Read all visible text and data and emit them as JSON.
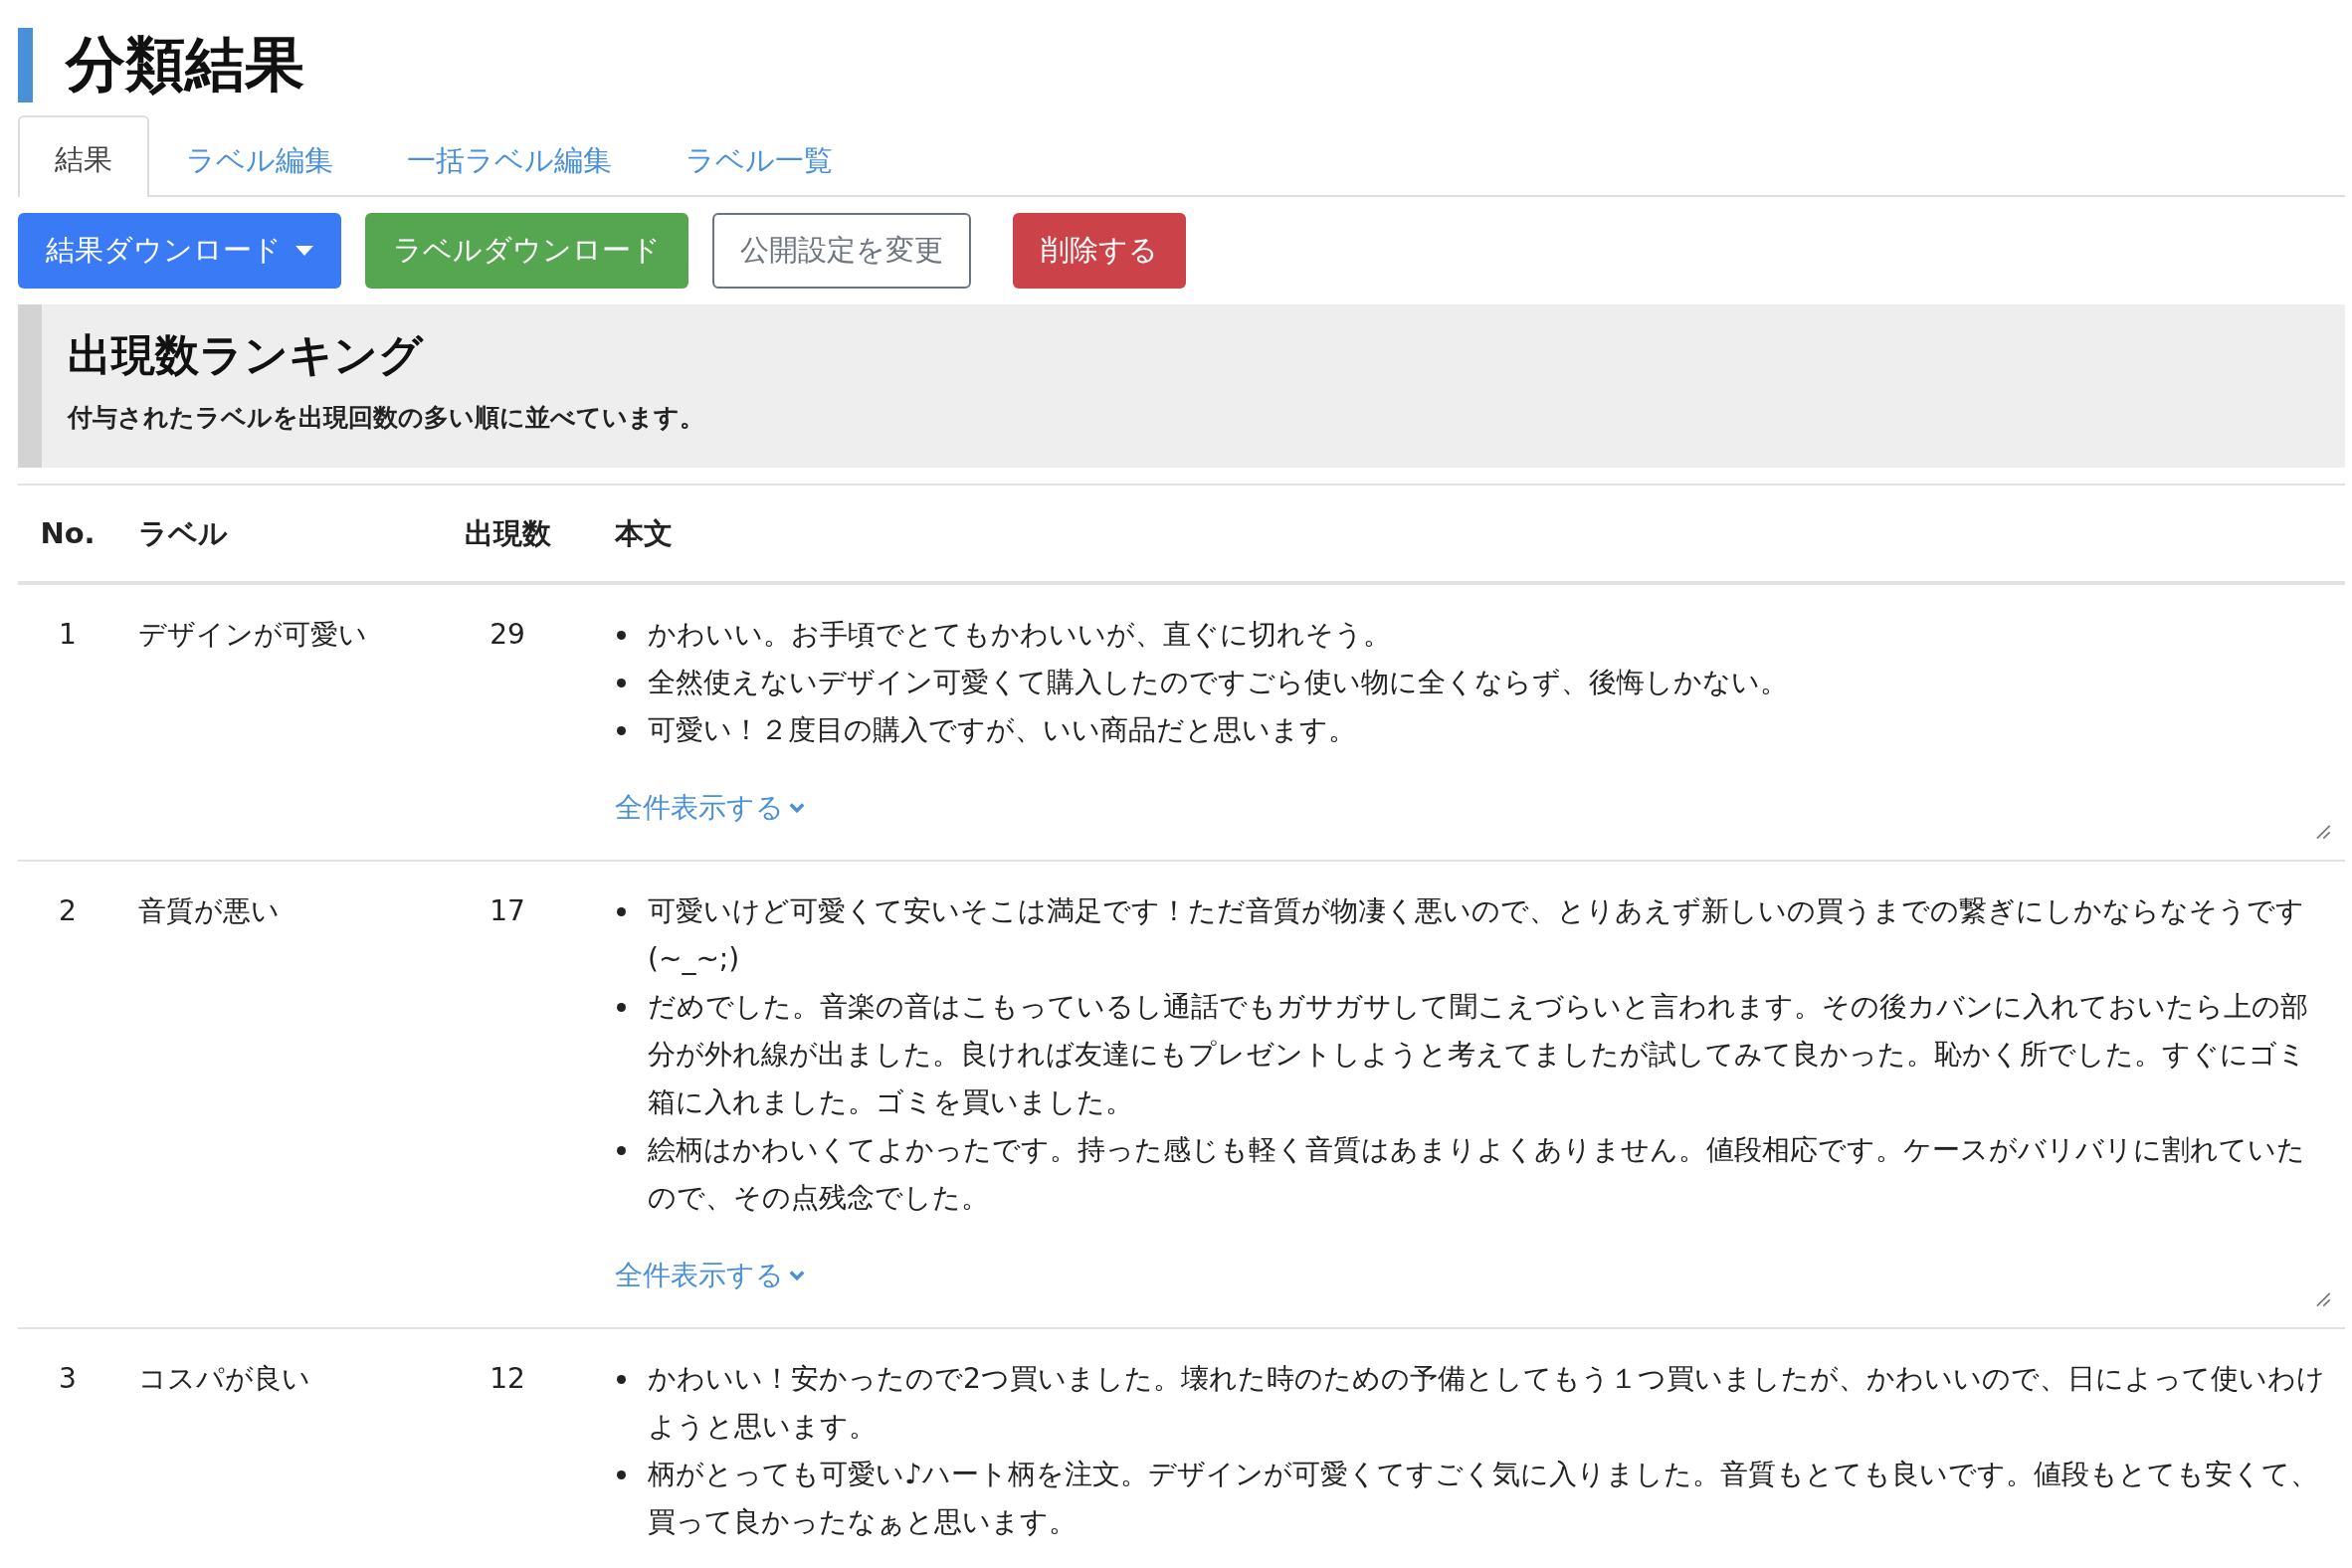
{
  "page": {
    "title": "分類結果"
  },
  "tabs": [
    {
      "label": "結果",
      "selected": true
    },
    {
      "label": "ラベル編集",
      "selected": false
    },
    {
      "label": "一括ラベル編集",
      "selected": false
    },
    {
      "label": "ラベル一覧",
      "selected": false
    }
  ],
  "buttons": [
    {
      "label": "結果ダウンロード",
      "kind": "primary",
      "dropdown": true
    },
    {
      "label": "ラベルダウンロード",
      "kind": "success",
      "dropdown": false
    },
    {
      "label": "公開設定を変更",
      "kind": "outline",
      "dropdown": false
    },
    {
      "label": "削除する",
      "kind": "danger",
      "dropdown": false
    }
  ],
  "panel": {
    "heading": "出現数ランキング",
    "description": "付与されたラベルを出現回数の多い順に並べています。"
  },
  "table": {
    "columns": [
      "No.",
      "ラベル",
      "出現数",
      "本文"
    ],
    "rows": [
      {
        "no": "1",
        "label": "デザインが可愛い",
        "count": "29",
        "texts": [
          "かわいい。お手頃でとてもかわいいが、直ぐに切れそう。",
          "全然使えないデザイン可愛くて購入したのですごら使い物に全くならず、後悔しかない。",
          "可愛い！２度目の購入ですが、いい商品だと思います。"
        ],
        "more": "全件表示する"
      },
      {
        "no": "2",
        "label": "音質が悪い",
        "count": "17",
        "texts": [
          "可愛いけど可愛くて安いそこは満足です！ただ音質が物凄く悪いので、とりあえず新しいの買うまでの繋ぎにしかならなそうです(~_~;)",
          "だめでした。音楽の音はこもっているし通話でもガサガサして聞こえづらいと言われます。その後カバンに入れておいたら上の部分が外れ線が出ました。良ければ友達にもプレゼントしようと考えてましたが試してみて良かった。恥かく所でした。すぐにゴミ箱に入れました。ゴミを買いました。",
          "絵柄はかわいくてよかったです。持った感じも軽く音質はあまりよくありません。値段相応です。ケースがバリバリに割れていたので、その点残念でした。"
        ],
        "more": "全件表示する"
      },
      {
        "no": "3",
        "label": "コスパが良い",
        "count": "12",
        "texts": [
          "かわいい！安かったので2つ買いました。壊れた時のための予備としてもう１つ買いましたが、かわいいので、日によって使いわけようと思います。",
          "柄がとっても可愛い♪ハート柄を注文。デザインが可愛くてすごく気に入りました。音質もとても良いです。値段もとても安くて、買って良かったなぁと思います。"
        ]
      }
    ]
  }
}
